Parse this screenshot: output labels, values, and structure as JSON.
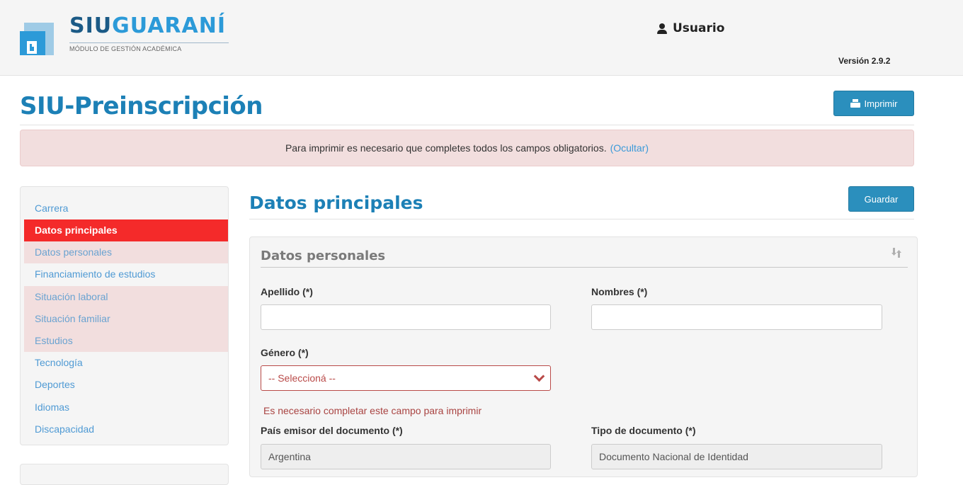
{
  "header": {
    "logo": {
      "siu": "SIU",
      "guarani": "GUARANÍ",
      "subtitle": "MÓDULO DE GESTIÓN ACADÉMICA"
    },
    "user_label": "Usuario",
    "version": "Versión 2.9.2"
  },
  "page": {
    "title": "SIU-Preinscripción",
    "print_button": "Imprimir"
  },
  "alert": {
    "message": "Para imprimir es necesario que completes todos los campos obligatorios.",
    "hide_link": "(Ocultar)"
  },
  "sidebar": {
    "items": [
      {
        "label": "Carrera"
      },
      {
        "label": "Datos principales"
      },
      {
        "label": "Datos personales"
      },
      {
        "label": "Financiamiento de estudios"
      },
      {
        "label": "Situación laboral"
      },
      {
        "label": "Situación familiar"
      },
      {
        "label": "Estudios"
      },
      {
        "label": "Tecnología"
      },
      {
        "label": "Deportes"
      },
      {
        "label": "Idiomas"
      },
      {
        "label": "Discapacidad"
      }
    ]
  },
  "main": {
    "section_title": "Datos principales",
    "save_button": "Guardar",
    "panel_title": "Datos personales",
    "fields": {
      "apellido": {
        "label": "Apellido (*)",
        "value": ""
      },
      "nombres": {
        "label": "Nombres (*)",
        "value": ""
      },
      "genero": {
        "label": "Género (*)",
        "value": "-- Seleccioná --",
        "error": "Es necesario completar este campo para imprimir"
      },
      "pais": {
        "label": "País emisor del documento (*)",
        "value": "Argentina"
      },
      "tipo_doc": {
        "label": "Tipo de documento (*)",
        "value": "Documento Nacional de Identidad"
      }
    }
  }
}
